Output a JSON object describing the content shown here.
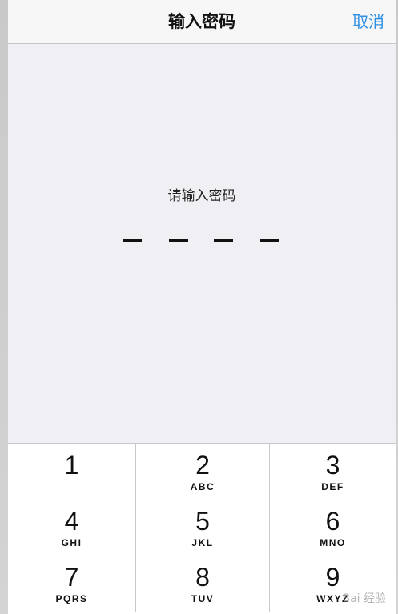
{
  "nav": {
    "title": "输入密码",
    "cancel_label": "取消"
  },
  "passcode": {
    "prompt": "请输入密码",
    "length": 4,
    "entered": 0
  },
  "keypad": {
    "rows": [
      [
        {
          "digit": "1",
          "letters": ""
        },
        {
          "digit": "2",
          "letters": "ABC"
        },
        {
          "digit": "3",
          "letters": "DEF"
        }
      ],
      [
        {
          "digit": "4",
          "letters": "GHI"
        },
        {
          "digit": "5",
          "letters": "JKL"
        },
        {
          "digit": "6",
          "letters": "MNO"
        }
      ],
      [
        {
          "digit": "7",
          "letters": "PQRS"
        },
        {
          "digit": "8",
          "letters": "TUV"
        },
        {
          "digit": "9",
          "letters": "WXYZ"
        }
      ]
    ]
  },
  "colors": {
    "accent": "#2f8fe3",
    "background": "#efeff4",
    "keypad": "#ffffff"
  },
  "watermark": "Bai 经验"
}
